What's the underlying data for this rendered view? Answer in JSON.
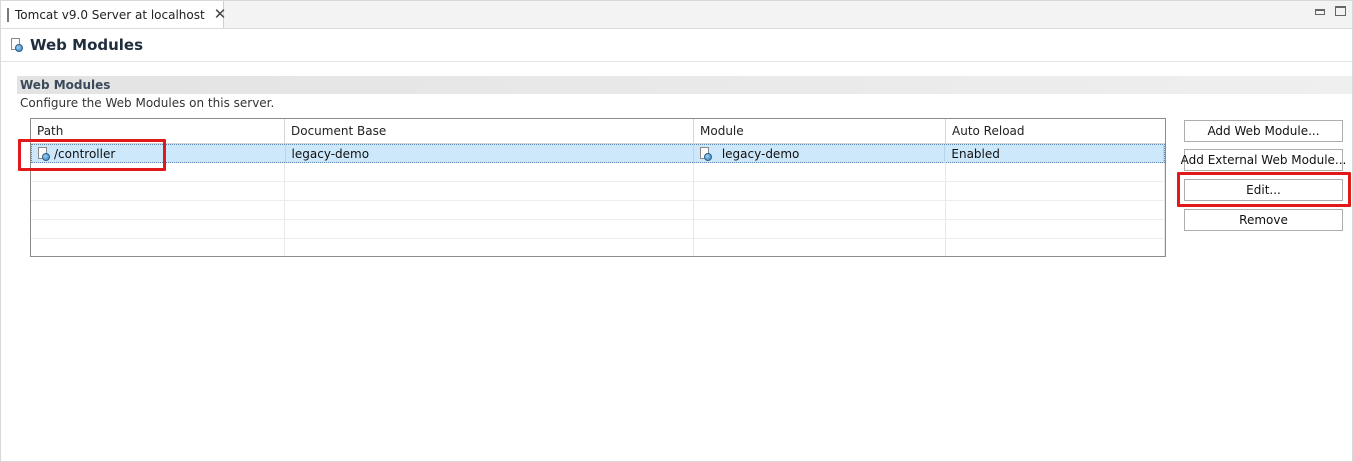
{
  "tab": {
    "title": "Tomcat v9.0 Server at localhost",
    "close_glyph": "✕"
  },
  "header": {
    "title": "Web Modules",
    "icon": "web-module-icon"
  },
  "section": {
    "title": "Web Modules",
    "description": "Configure the Web Modules on this server."
  },
  "table": {
    "columns": [
      "Path",
      "Document Base",
      "Module",
      "Auto Reload"
    ],
    "rows": [
      {
        "path": "/controller",
        "document_base": "legacy-demo",
        "module": "legacy-demo",
        "auto_reload": "Enabled",
        "selected": true
      }
    ]
  },
  "buttons": {
    "add_web_module": "Add Web Module...",
    "add_external_web_module": "Add External Web Module...",
    "edit": "Edit...",
    "remove": "Remove"
  },
  "colors": {
    "selection": "#cde8fb",
    "highlight": "#e01a1a",
    "section_bar": "#e3e3e3"
  }
}
